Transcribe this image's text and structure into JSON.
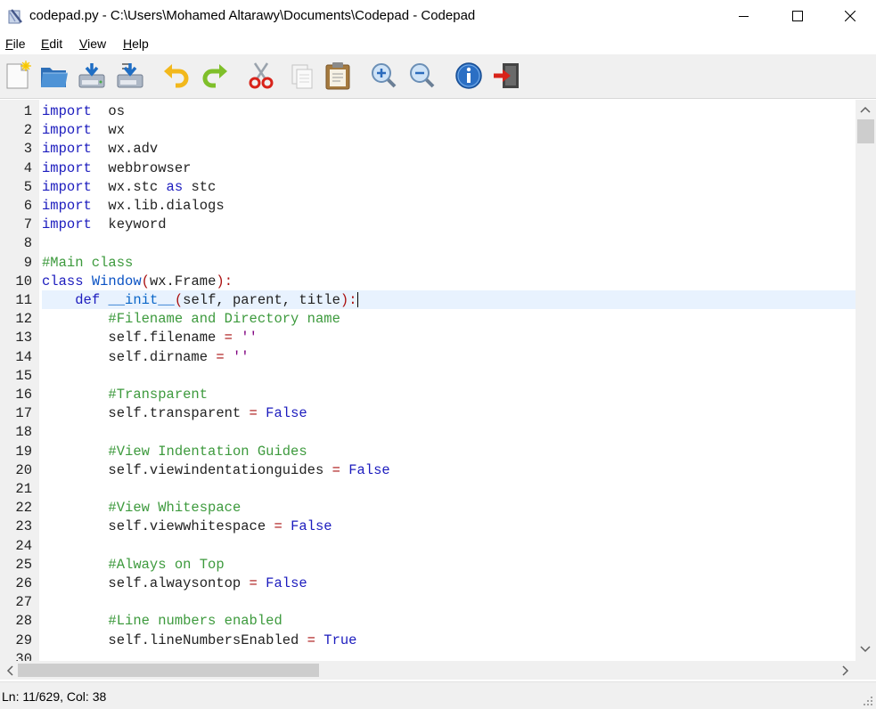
{
  "window": {
    "title": "codepad.py - C:\\Users\\Mohamed Altarawy\\Documents\\Codepad - Codepad"
  },
  "menu": {
    "items": [
      {
        "mnemonic": "F",
        "rest": "ile"
      },
      {
        "mnemonic": "E",
        "rest": "dit"
      },
      {
        "mnemonic": "V",
        "rest": "iew"
      },
      {
        "mnemonic": "H",
        "rest": "elp"
      }
    ]
  },
  "toolbar": {
    "icons": [
      "new-file-icon",
      "open-folder-icon",
      "save-icon",
      "save-as-icon",
      "undo-icon",
      "redo-icon",
      "cut-icon",
      "copy-icon",
      "paste-icon",
      "zoom-in-icon",
      "zoom-out-icon",
      "info-icon",
      "exit-icon"
    ]
  },
  "editor": {
    "current_line": 11,
    "lines": [
      {
        "n": "1",
        "t": [
          [
            "kw",
            "import"
          ],
          [
            "",
            "  os"
          ]
        ]
      },
      {
        "n": "2",
        "t": [
          [
            "kw",
            "import"
          ],
          [
            "",
            "  wx"
          ]
        ]
      },
      {
        "n": "3",
        "t": [
          [
            "kw",
            "import"
          ],
          [
            "",
            "  wx.adv"
          ]
        ]
      },
      {
        "n": "4",
        "t": [
          [
            "kw",
            "import"
          ],
          [
            "",
            "  webbrowser"
          ]
        ]
      },
      {
        "n": "5",
        "t": [
          [
            "kw",
            "import"
          ],
          [
            "",
            "  wx.stc "
          ],
          [
            "kw",
            "as"
          ],
          [
            "",
            " stc"
          ]
        ]
      },
      {
        "n": "6",
        "t": [
          [
            "kw",
            "import"
          ],
          [
            "",
            "  wx.lib.dialogs"
          ]
        ]
      },
      {
        "n": "7",
        "t": [
          [
            "kw",
            "import"
          ],
          [
            "",
            "  keyword"
          ]
        ]
      },
      {
        "n": "8",
        "t": []
      },
      {
        "n": "9",
        "t": [
          [
            "cm",
            "#Main class"
          ]
        ]
      },
      {
        "n": "10",
        "t": [
          [
            "kw",
            "class"
          ],
          [
            "",
            " "
          ],
          [
            "cls",
            "Window"
          ],
          [
            "op",
            "("
          ],
          [
            "",
            "wx.Frame"
          ],
          [
            "op",
            ")"
          ],
          [
            "op",
            ":"
          ]
        ]
      },
      {
        "n": "11",
        "t": [
          [
            "",
            "    "
          ],
          [
            "kw",
            "def"
          ],
          [
            "",
            " "
          ],
          [
            "fn",
            "__init__"
          ],
          [
            "op",
            "("
          ],
          [
            "",
            "self, parent, title"
          ],
          [
            "op",
            ")"
          ],
          [
            "op",
            ":"
          ]
        ]
      },
      {
        "n": "12",
        "t": [
          [
            "",
            "        "
          ],
          [
            "cm",
            "#Filename and Directory name"
          ]
        ]
      },
      {
        "n": "13",
        "t": [
          [
            "",
            "        self.filename "
          ],
          [
            "op",
            "="
          ],
          [
            "",
            " "
          ],
          [
            "str",
            "''"
          ]
        ]
      },
      {
        "n": "14",
        "t": [
          [
            "",
            "        self.dirname "
          ],
          [
            "op",
            "="
          ],
          [
            "",
            " "
          ],
          [
            "str",
            "''"
          ]
        ]
      },
      {
        "n": "15",
        "t": []
      },
      {
        "n": "16",
        "t": [
          [
            "",
            "        "
          ],
          [
            "cm",
            "#Transparent"
          ]
        ]
      },
      {
        "n": "17",
        "t": [
          [
            "",
            "        self.transparent "
          ],
          [
            "op",
            "="
          ],
          [
            "",
            " "
          ],
          [
            "kw",
            "False"
          ]
        ]
      },
      {
        "n": "18",
        "t": []
      },
      {
        "n": "19",
        "t": [
          [
            "",
            "        "
          ],
          [
            "cm",
            "#View Indentation Guides"
          ]
        ]
      },
      {
        "n": "20",
        "t": [
          [
            "",
            "        self.viewindentationguides "
          ],
          [
            "op",
            "="
          ],
          [
            "",
            " "
          ],
          [
            "kw",
            "False"
          ]
        ]
      },
      {
        "n": "21",
        "t": []
      },
      {
        "n": "22",
        "t": [
          [
            "",
            "        "
          ],
          [
            "cm",
            "#View Whitespace"
          ]
        ]
      },
      {
        "n": "23",
        "t": [
          [
            "",
            "        self.viewwhitespace "
          ],
          [
            "op",
            "="
          ],
          [
            "",
            " "
          ],
          [
            "kw",
            "False"
          ]
        ]
      },
      {
        "n": "24",
        "t": []
      },
      {
        "n": "25",
        "t": [
          [
            "",
            "        "
          ],
          [
            "cm",
            "#Always on Top"
          ]
        ]
      },
      {
        "n": "26",
        "t": [
          [
            "",
            "        self.alwaysontop "
          ],
          [
            "op",
            "="
          ],
          [
            "",
            " "
          ],
          [
            "kw",
            "False"
          ]
        ]
      },
      {
        "n": "27",
        "t": []
      },
      {
        "n": "28",
        "t": [
          [
            "",
            "        "
          ],
          [
            "cm",
            "#Line numbers enabled"
          ]
        ]
      },
      {
        "n": "29",
        "t": [
          [
            "",
            "        self.lineNumbersEnabled "
          ],
          [
            "op",
            "="
          ],
          [
            "",
            " "
          ],
          [
            "kw",
            "True"
          ]
        ]
      },
      {
        "n": "30",
        "t": []
      }
    ]
  },
  "status": {
    "text": "Ln: 11/629, Col: 38"
  }
}
